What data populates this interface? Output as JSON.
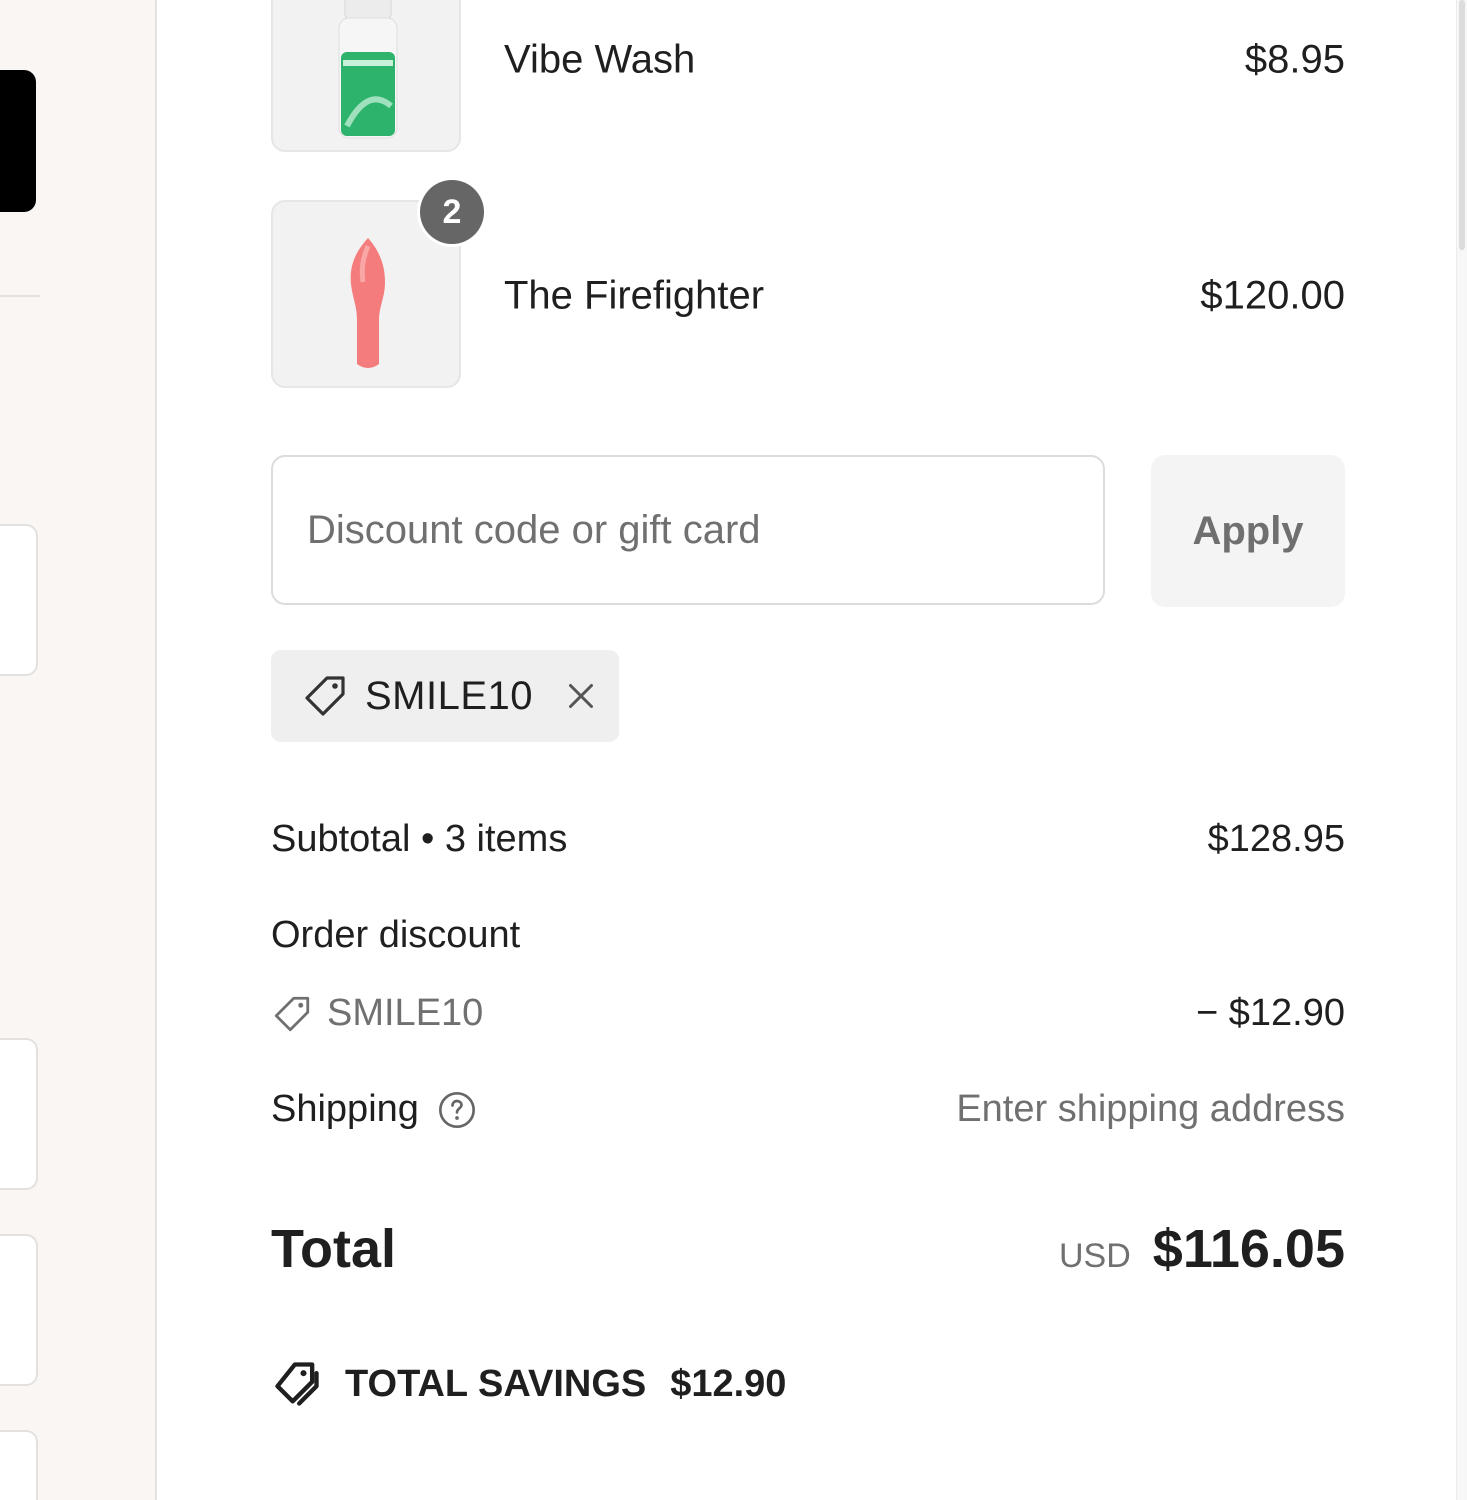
{
  "items": [
    {
      "name": "Vibe Wash",
      "price": "$8.95",
      "quantity": null
    },
    {
      "name": "The Firefighter",
      "price": "$120.00",
      "quantity": "2"
    }
  ],
  "discount": {
    "placeholder": "Discount code or gift card",
    "apply_label": "Apply",
    "applied_code": "SMILE10"
  },
  "summary": {
    "subtotal_label": "Subtotal • 3 items",
    "subtotal_value": "$128.95",
    "order_discount_label": "Order discount",
    "order_discount_code": "SMILE10",
    "order_discount_value": "− $12.90",
    "shipping_label": "Shipping",
    "shipping_value": "Enter shipping address",
    "total_label": "Total",
    "currency": "USD",
    "total_value": "$116.05",
    "savings_label": "TOTAL SAVINGS",
    "savings_value": "$12.90"
  },
  "icons": {
    "tag": "tag-icon",
    "remove": "close-icon",
    "help": "help-circle-icon",
    "savings": "savings-tag-icon"
  },
  "colors": {
    "left_bg": "#faf6f3",
    "badge": "#666666",
    "wash_green": "#2db36b",
    "firefighter_pink": "#f47c7c"
  }
}
